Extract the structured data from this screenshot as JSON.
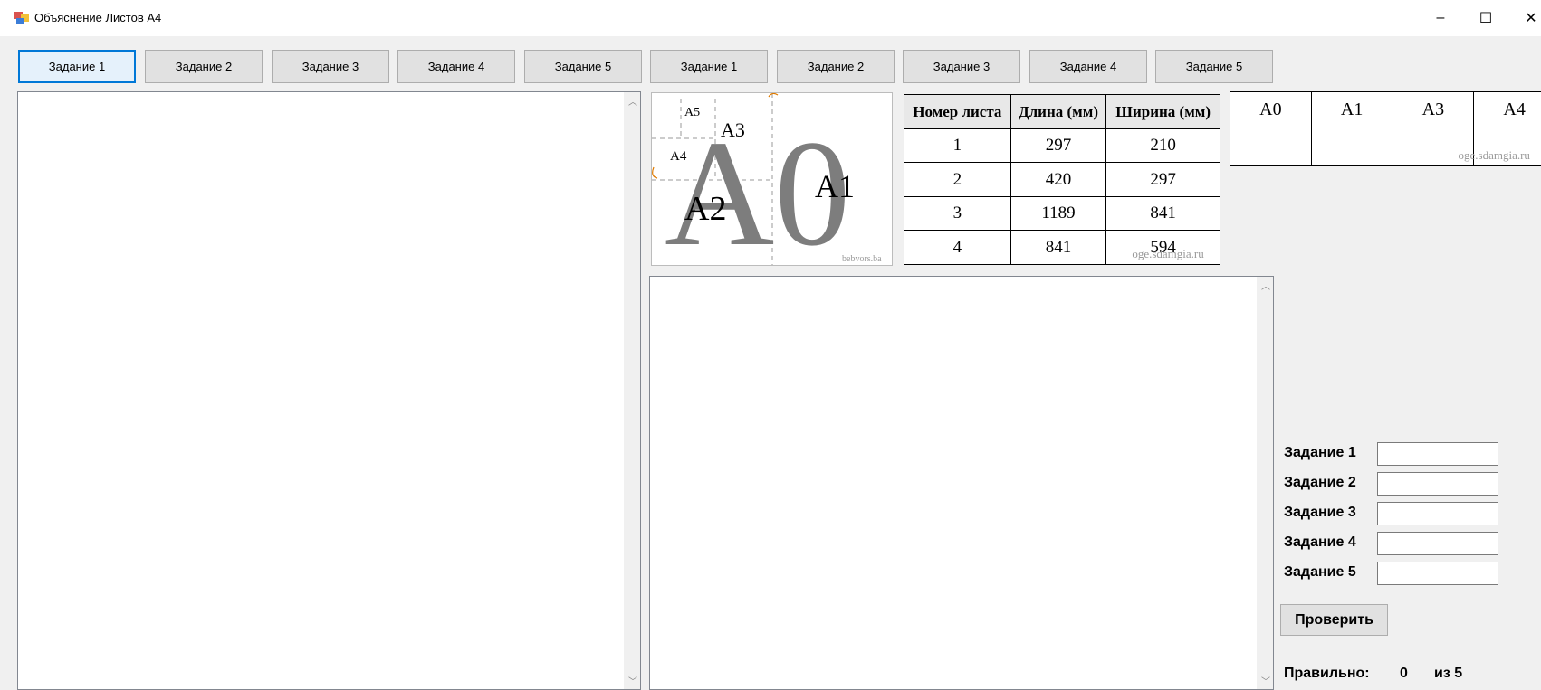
{
  "window": {
    "title": "Объяснение Листов А4",
    "minimize": "–",
    "maximize": "☐",
    "close": "✕"
  },
  "tabs_left": [
    "Задание 1",
    "Задание 2",
    "Задание 3",
    "Задание 4",
    "Задание 5"
  ],
  "tabs_right": [
    "Задание 1",
    "Задание 2",
    "Задание 3",
    "Задание 4",
    "Задание 5"
  ],
  "diagram": {
    "labels": {
      "a0": "A0",
      "a1": "A1",
      "a2": "A2",
      "a3": "A3",
      "a4": "A4",
      "a5": "A5"
    },
    "watermark": "bebvors.ba"
  },
  "sheet_table": {
    "headers": [
      "Номер листа",
      "Длина (мм)",
      "Ширина (мм)"
    ],
    "rows": [
      [
        "1",
        "297",
        "210"
      ],
      [
        "2",
        "420",
        "297"
      ],
      [
        "3",
        "1189",
        "841"
      ],
      [
        "4",
        "841",
        "594"
      ]
    ],
    "watermark": "oge.sdamgia.ru"
  },
  "format_table": {
    "headers": [
      "A0",
      "A1",
      "A3",
      "A4"
    ],
    "watermark": "oge.sdamgia.ru"
  },
  "answers": {
    "labels": [
      "Задание 1",
      "Задание 2",
      "Задание 3",
      "Задание 4",
      "Задание 5"
    ],
    "values": [
      "",
      "",
      "",
      "",
      ""
    ],
    "check_label": "Проверить"
  },
  "result": {
    "label": "Правильно:",
    "count": "0",
    "total": "из 5"
  },
  "colors": {
    "accent": "#0078d7",
    "diagram_gray": "#7d7d7d",
    "guide_orange": "#e07b00"
  }
}
